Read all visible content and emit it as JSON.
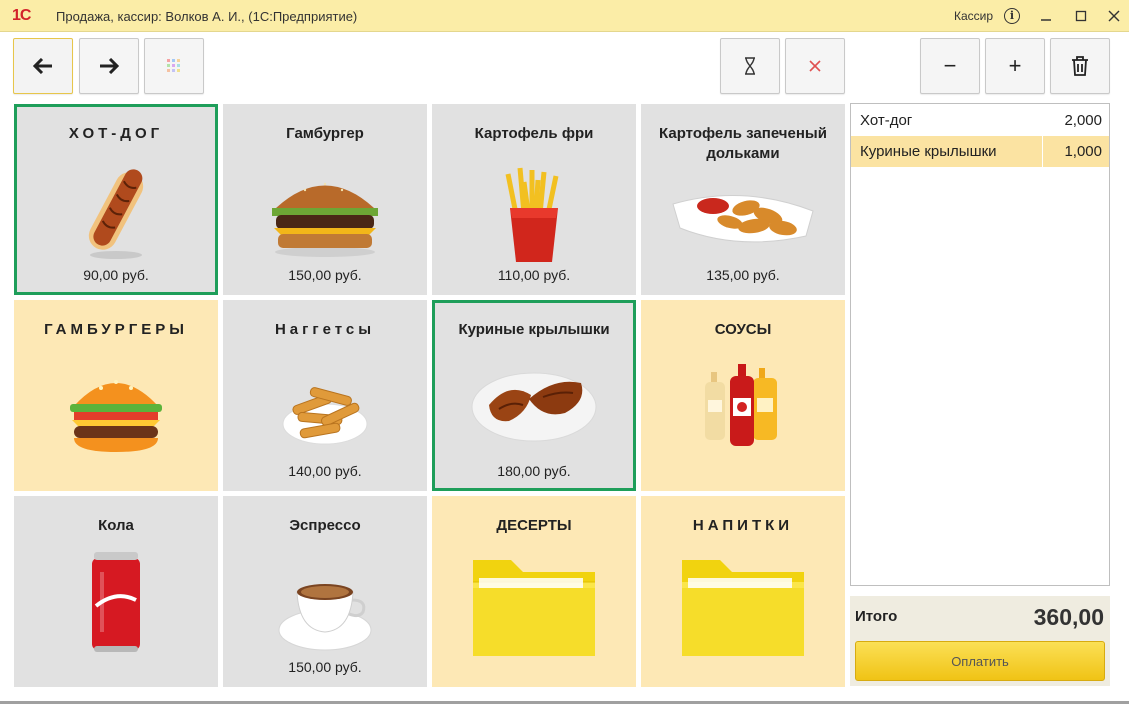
{
  "window": {
    "logo": "1С",
    "title": "Продажа, кассир: Волков А. И.,  (1С:Предприятие)",
    "user": "Кассир"
  },
  "toolbar": {
    "back_icon": "arrow-left-icon",
    "forward_icon": "arrow-right-icon",
    "grid_icon": "grid-icon",
    "timer_icon": "hourglass-icon",
    "cancel_icon": "close-icon",
    "minus_label": "−",
    "plus_label": "+",
    "delete_icon": "trash-icon"
  },
  "tiles": [
    {
      "name": "ХОТ-ДОГ",
      "price": "90,00 руб.",
      "image": "hotdog",
      "selected": true
    },
    {
      "name": "Гамбургер",
      "price": "150,00 руб.",
      "image": "burger-photo"
    },
    {
      "name": "Картофель фри",
      "price": "110,00 руб.",
      "image": "fries"
    },
    {
      "name": "Картофель запеченый дольками",
      "price": "135,00 руб.",
      "image": "wedges"
    },
    {
      "name": "ГАМБУРГЕРЫ",
      "price": "",
      "image": "burger-icon",
      "category": true
    },
    {
      "name": "Наггетсы",
      "price": "140,00 руб.",
      "image": "nuggets"
    },
    {
      "name": "Куриные крылышки",
      "price": "180,00 руб.",
      "image": "wings",
      "selected": true
    },
    {
      "name": "СОУСЫ",
      "price": "",
      "image": "sauces",
      "category": true
    },
    {
      "name": "Кола",
      "price": "",
      "image": "cola"
    },
    {
      "name": "Эспрессо",
      "price": "150,00 руб.",
      "image": "espresso"
    },
    {
      "name": "ДЕСЕРТЫ",
      "price": "",
      "image": "folder",
      "category": true
    },
    {
      "name": "НАПИТКИ",
      "price": "",
      "image": "folder",
      "category": true
    }
  ],
  "receipt": {
    "rows": [
      {
        "name": "Хот-дог",
        "qty": "2,000"
      },
      {
        "name": "Куриные крылышки",
        "qty": "1,000"
      }
    ],
    "total_label": "Итого",
    "total_value": "360,00",
    "pay_label": "Оплатить"
  },
  "colors": {
    "titlebar": "#fbeda7",
    "tile_item": "#e1e1e1",
    "tile_category": "#fde8b5",
    "selected_border": "#1e9e5a",
    "pay_button": "#f5cf2b"
  }
}
